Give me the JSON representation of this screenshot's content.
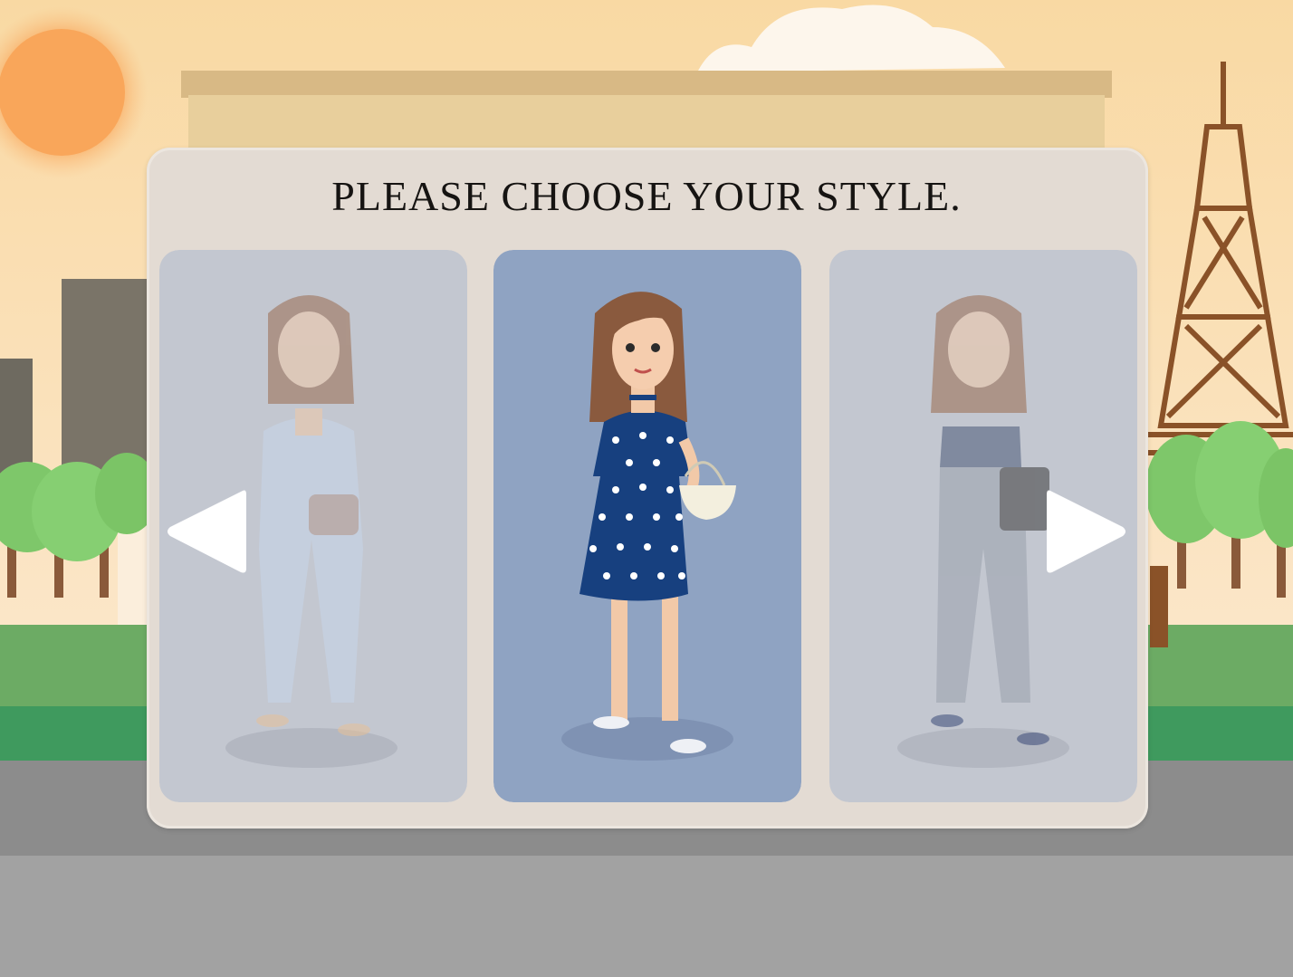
{
  "screen": {
    "title": "PLEASE CHOOSE YOUR STYLE."
  },
  "styles": [
    {
      "name": "suit-outfit",
      "selected": false
    },
    {
      "name": "polka-dot-dress",
      "selected": true
    },
    {
      "name": "crop-top-outfit",
      "selected": false
    }
  ],
  "colors": {
    "sky": "#f7d7a6",
    "sun": "#f9a65a",
    "panel": "#e3dbd3",
    "card_selected": "#8fa4c4",
    "card_dim": "#c2c7d1",
    "dress": "#17407f",
    "road": "#9e9e9e",
    "grass": "#5fa15a"
  },
  "icons": {
    "prev": "left-arrow-icon",
    "next": "right-arrow-icon"
  }
}
